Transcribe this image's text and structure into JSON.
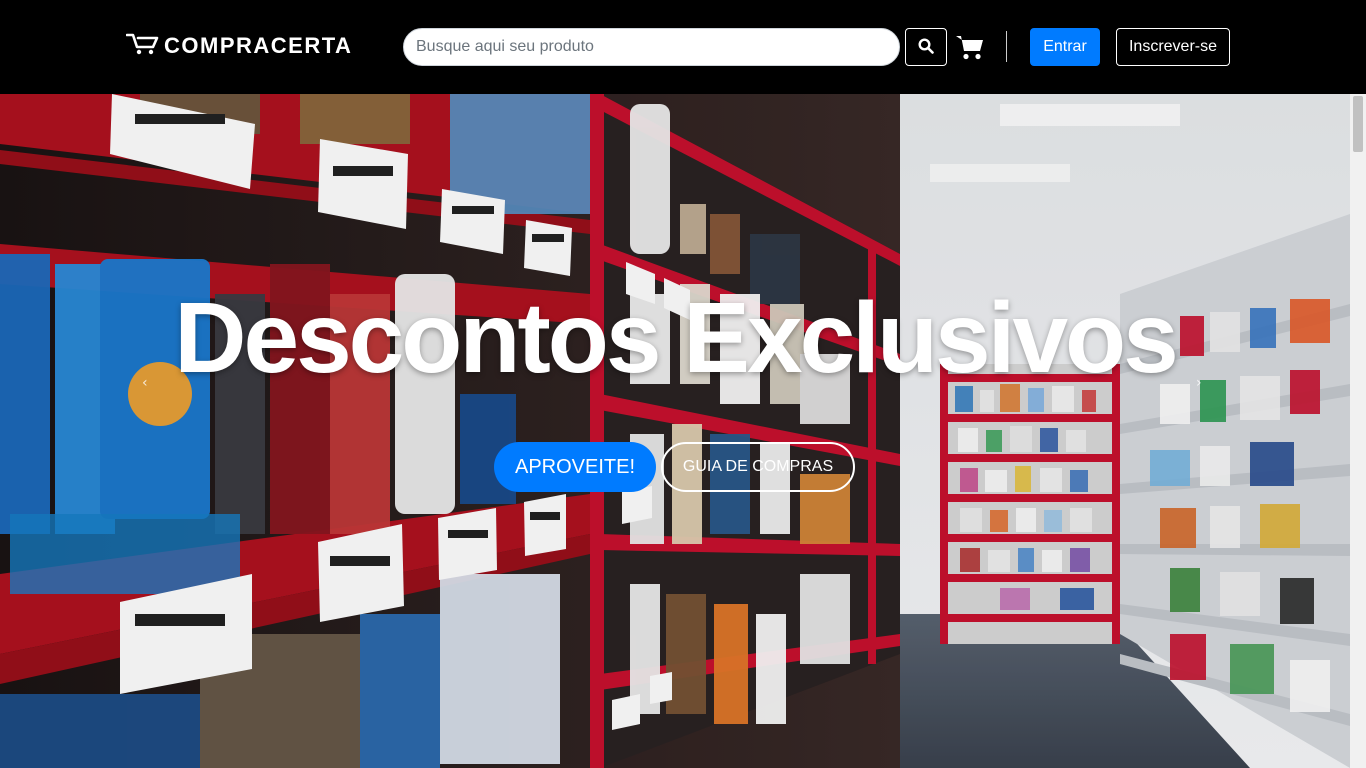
{
  "navbar": {
    "brand": "COMPRACERTA",
    "brand_icon": "cart-logo-icon",
    "search_placeholder": "Busque aqui seu produto",
    "search_icon": "search-icon",
    "cart_icon": "shopping-cart-icon",
    "login_label": "Entrar",
    "signup_label": "Inscrever-se"
  },
  "hero": {
    "title": "Descontos Exclusivos",
    "primary_button": "APROVEITE!",
    "secondary_button": "GUIA DE COMPRAS",
    "prev_icon": "chevron-left-icon",
    "next_icon": "chevron-right-icon",
    "prev_glyph": "‹",
    "next_glyph": "›"
  },
  "colors": {
    "navbar_bg": "#000000",
    "primary": "#007bff",
    "shelf_red": "#c8102e",
    "text_white": "#ffffff"
  }
}
